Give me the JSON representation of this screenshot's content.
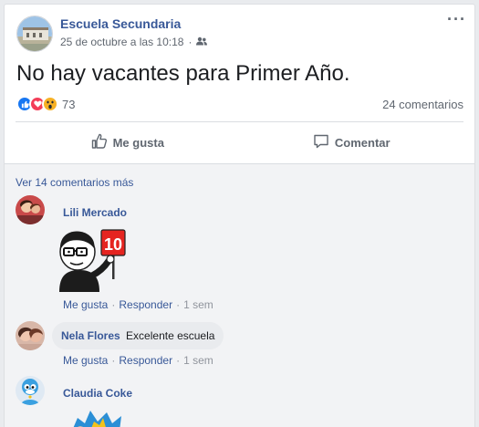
{
  "post": {
    "page_name": "Escuela Secundaria",
    "timestamp": "25 de octubre a las 10:18",
    "privacy_icon": "friends-icon",
    "text": "No hay vacantes para Primer Año.",
    "reactions": [
      "like",
      "love",
      "wow"
    ],
    "reaction_count": "73",
    "comment_count": "24 comentarios"
  },
  "actions": {
    "like_label": "Me gusta",
    "comment_label": "Comentar"
  },
  "comments": {
    "more_label": "Ver 14 comentarios más",
    "items": [
      {
        "author": "Lili Mercado",
        "text": "",
        "sticker": "10",
        "like": "Me gusta",
        "reply": "Responder",
        "time": "1 sem"
      },
      {
        "author": "Nela Flores",
        "text": "Excelente escuela",
        "like": "Me gusta",
        "reply": "Responder",
        "time": "1 sem"
      },
      {
        "author": "Claudia Coke",
        "text": ""
      }
    ]
  },
  "colors": {
    "link": "#385898",
    "meta": "#606770",
    "like_blue": "#1877f2",
    "love_red": "#f33e58",
    "wow_yellow": "#f7b125"
  }
}
